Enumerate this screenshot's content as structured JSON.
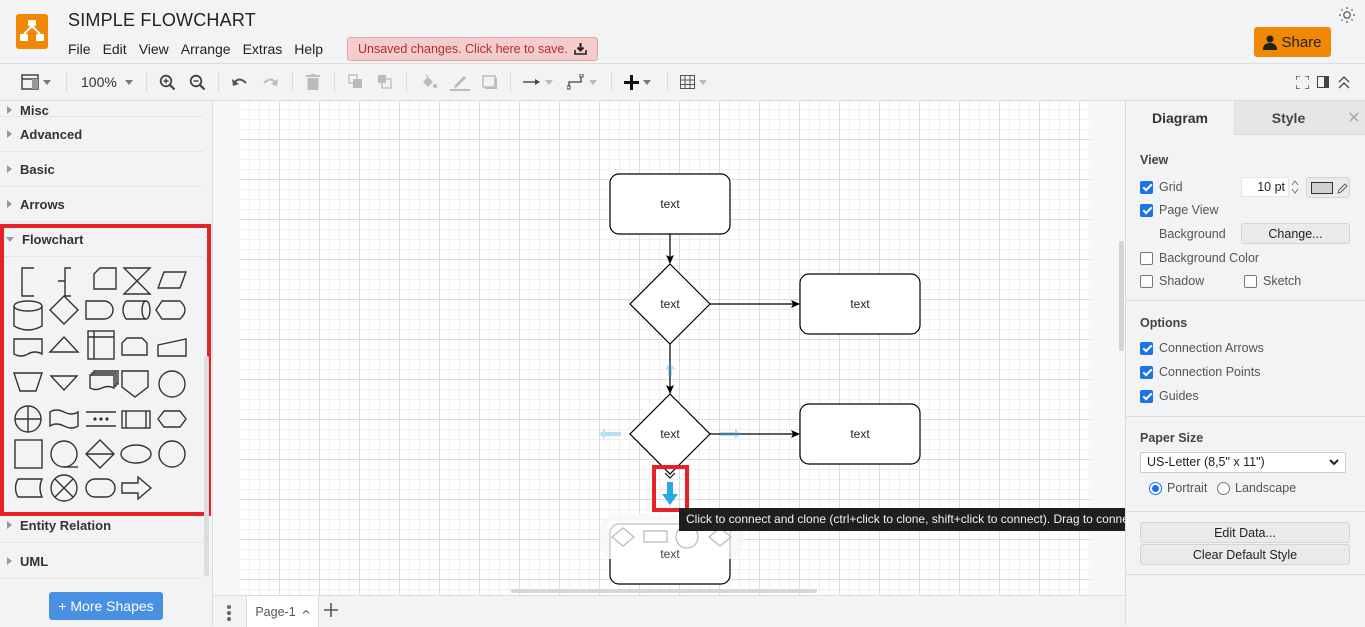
{
  "app": {
    "title": "SIMPLE FLOWCHART",
    "brand_color": "#f08705",
    "menu": [
      "File",
      "Edit",
      "View",
      "Arrange",
      "Extras",
      "Help"
    ],
    "unsaved_notice": "Unsaved changes. Click here to save.",
    "share_label": "Share"
  },
  "toolbar": {
    "zoom_level": "100%",
    "icons": [
      "format-panel-icon",
      "zoom-in-icon",
      "zoom-out-icon",
      "undo-icon",
      "redo-icon",
      "delete-icon",
      "to-front-icon",
      "to-back-icon",
      "fill-color-icon",
      "line-color-icon",
      "shadow-icon",
      "connection-icon",
      "waypoints-icon",
      "insert-icon",
      "table-icon",
      "fullscreen-icon",
      "format-toggle-icon",
      "collapse-icon"
    ]
  },
  "sidebar": {
    "partial_section": "Misc",
    "sections": [
      {
        "label": "Advanced",
        "expanded": false
      },
      {
        "label": "Basic",
        "expanded": false
      },
      {
        "label": "Arrows",
        "expanded": false
      },
      {
        "label": "Flowchart",
        "expanded": true
      },
      {
        "label": "Entity Relation",
        "expanded": false
      },
      {
        "label": "UML",
        "expanded": false
      }
    ],
    "flowchart_shapes": [
      "annotation-1",
      "annotation-2",
      "card",
      "collate",
      "data",
      "database",
      "decision",
      "delay",
      "direct-data",
      "display",
      "document",
      "extract",
      "internal-storage",
      "loop-limit",
      "manual-input",
      "manual-operation",
      "merge",
      "multi-document",
      "off-page-reference",
      "on-page-reference",
      "or",
      "paper-tape",
      "parallel-mode",
      "predefined-process",
      "preparation",
      "process",
      "sequential-data",
      "sort",
      "start-1",
      "start-2",
      "stored-data",
      "summing-function",
      "terminator",
      "transfer"
    ],
    "more_shapes_label": "+ More Shapes"
  },
  "canvas": {
    "nodes": [
      {
        "id": "n1",
        "type": "rounded-rect",
        "label": "text"
      },
      {
        "id": "n2",
        "type": "diamond",
        "label": "text"
      },
      {
        "id": "n3",
        "type": "rounded-rect",
        "label": "text"
      },
      {
        "id": "n4",
        "type": "diamond",
        "label": "text"
      },
      {
        "id": "n5",
        "type": "rounded-rect",
        "label": "text"
      },
      {
        "id": "n6",
        "type": "rounded-rect",
        "label": "text"
      }
    ],
    "edges": [
      {
        "from": "n1",
        "to": "n2"
      },
      {
        "from": "n2",
        "to": "n3"
      },
      {
        "from": "n2",
        "to": "n4"
      },
      {
        "from": "n4",
        "to": "n5"
      }
    ],
    "tooltip": "Click to connect and clone (ctrl+click to clone, shift+click to connect). Drag to connect (ctrl+drag to clone).",
    "hover_arrow_color": "#29a9e1"
  },
  "bottombar": {
    "page_tab": "Page-1"
  },
  "format_panel": {
    "tabs": [
      "Diagram",
      "Style"
    ],
    "active_tab": "Diagram",
    "view": {
      "title": "View",
      "grid": {
        "label": "Grid",
        "checked": true,
        "size": "10 pt",
        "color": "#d0d0d0"
      },
      "page_view": {
        "label": "Page View",
        "checked": true
      },
      "background_label": "Background",
      "change_button": "Change...",
      "background_color": {
        "label": "Background Color",
        "checked": false
      },
      "shadow": {
        "label": "Shadow",
        "checked": false
      },
      "sketch": {
        "label": "Sketch",
        "checked": false
      }
    },
    "options": {
      "title": "Options",
      "connection_arrows": {
        "label": "Connection Arrows",
        "checked": true
      },
      "connection_points": {
        "label": "Connection Points",
        "checked": true
      },
      "guides": {
        "label": "Guides",
        "checked": true
      }
    },
    "paper_size": {
      "title": "Paper Size",
      "selected": "US-Letter (8,5\" x 11\")",
      "orientation": [
        {
          "label": "Portrait",
          "selected": true
        },
        {
          "label": "Landscape",
          "selected": false
        }
      ]
    },
    "edit_data_button": "Edit Data...",
    "clear_default_style_button": "Clear Default Style"
  }
}
